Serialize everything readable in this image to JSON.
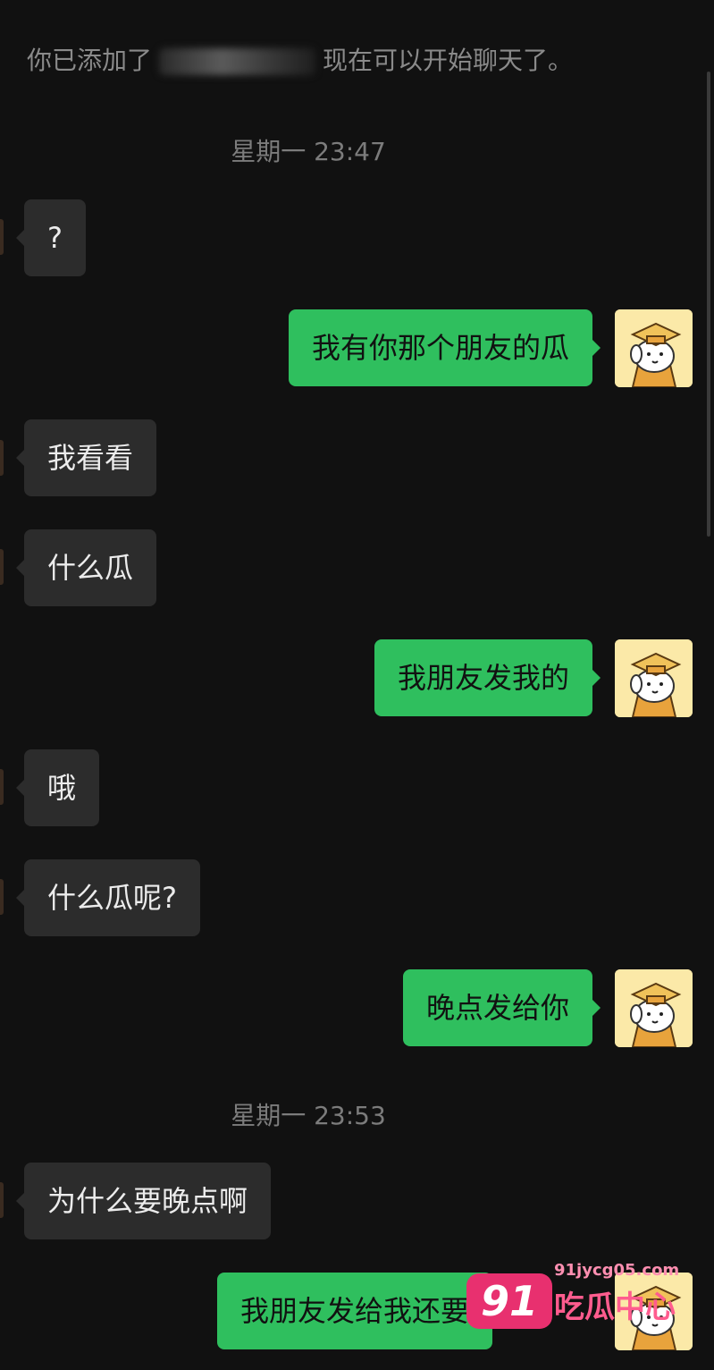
{
  "system_note": {
    "prefix": "你已添加了",
    "suffix": "现在可以开始聊天了。"
  },
  "timestamps": [
    "星期一 23:47",
    "星期一 23:53"
  ],
  "messages": [
    {
      "side": "in",
      "text": "?"
    },
    {
      "side": "out",
      "text": "我有你那个朋友的瓜"
    },
    {
      "side": "in",
      "text": "我看看"
    },
    {
      "side": "in",
      "text": "什么瓜"
    },
    {
      "side": "out",
      "text": "我朋友发我的"
    },
    {
      "side": "in",
      "text": "哦"
    },
    {
      "side": "in",
      "text": "什么瓜呢?"
    },
    {
      "side": "out",
      "text": "晚点发给你"
    },
    {
      "side": "in",
      "text": "为什么要晚点啊"
    },
    {
      "side": "out",
      "text": "我朋友发给我还要"
    }
  ],
  "icons": {
    "avatar": "cartoon-dog-graduate-avatar-icon"
  },
  "watermark": {
    "badge": "91",
    "url": "91jycg05.com",
    "name": "吃瓜中心"
  },
  "colors": {
    "background": "#111111",
    "incoming_bubble": "#2c2c2c",
    "outgoing_bubble": "#2fbf5e",
    "meta_text": "#7c7c7c"
  }
}
